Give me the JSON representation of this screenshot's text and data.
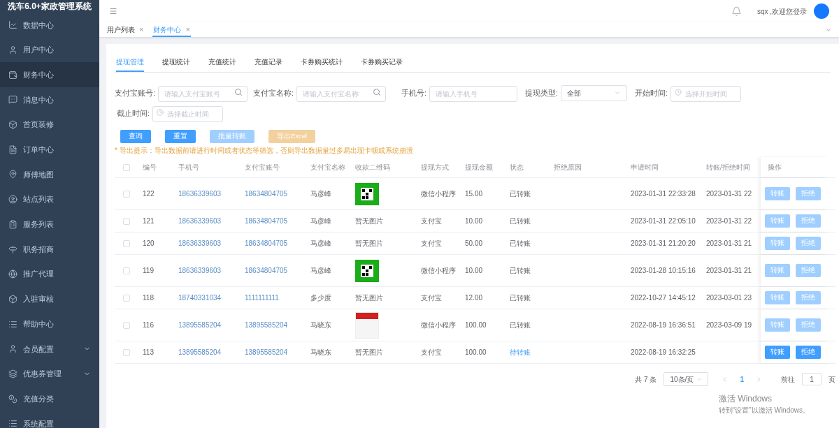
{
  "sidebar": {
    "title": "洗车6.0+家政管理系统",
    "items": [
      {
        "label": "数据中心",
        "selected": false
      },
      {
        "label": "用户中心",
        "selected": false
      },
      {
        "label": "财务中心",
        "selected": true
      },
      {
        "label": "消息中心",
        "selected": false
      },
      {
        "label": "首页装修",
        "selected": false
      },
      {
        "label": "订单中心",
        "selected": false
      },
      {
        "label": "师傅地图",
        "selected": false
      },
      {
        "label": "站点列表",
        "selected": false
      },
      {
        "label": "服务列表",
        "selected": false
      },
      {
        "label": "职务招商",
        "selected": false
      },
      {
        "label": "推广代理",
        "selected": false
      },
      {
        "label": "入驻审核",
        "selected": false
      },
      {
        "label": "帮助中心",
        "selected": false
      },
      {
        "label": "会员配置",
        "selected": false,
        "expanded": false
      },
      {
        "label": "优惠券管理",
        "selected": false,
        "expanded": false
      },
      {
        "label": "充值分类",
        "selected": false
      },
      {
        "label": "系统配置",
        "selected": false
      }
    ]
  },
  "header": {
    "greeting": "sqx ,欢迎您登录"
  },
  "page_tabs": [
    {
      "label": "用户列表",
      "close": "×",
      "selected": false
    },
    {
      "label": "财务中心",
      "close": "×",
      "selected": true
    }
  ],
  "section_tabs": [
    {
      "label": "提现管理",
      "selected": true
    },
    {
      "label": "提现统计",
      "selected": false
    },
    {
      "label": "充值统计",
      "selected": false
    },
    {
      "label": "充值记录",
      "selected": false
    },
    {
      "label": "卡券购买统计",
      "selected": false
    },
    {
      "label": "卡券购买记录",
      "selected": false
    }
  ],
  "filters": [
    {
      "label": "支付宝账号:",
      "kind": "search",
      "placeholder": "请输入支付宝账号"
    },
    {
      "label": "支付宝名称:",
      "kind": "search",
      "placeholder": "请输入支付宝名称"
    },
    {
      "label": "手机号:",
      "kind": "text",
      "placeholder": "请输入手机号"
    },
    {
      "label": "提现类型:",
      "kind": "select",
      "value": "全部"
    },
    {
      "label": "开始时间:",
      "kind": "date",
      "placeholder": "选择开始时间"
    },
    {
      "label": "截止时间:",
      "kind": "date",
      "placeholder": "选择截止时间"
    }
  ],
  "actions": [
    {
      "label": "查询",
      "kind": "primary",
      "disabled": false
    },
    {
      "label": "重置",
      "kind": "primary",
      "disabled": false
    },
    {
      "label": "批量转账",
      "kind": "primary",
      "disabled": true
    },
    {
      "label": "导出Excel",
      "kind": "warning",
      "disabled": true
    }
  ],
  "export_hint": "* 导出提示：导出数据前请进行时间或者状态等筛选，否则导出数据量过多易出现卡顿或系统崩溃",
  "table": {
    "header_checked": false,
    "columns": [
      "编号",
      "手机号",
      "支付宝账号",
      "支付宝名称",
      "收款二维码",
      "提现方式",
      "提现金额",
      "状态",
      "拒绝原因",
      "申请时间",
      "转账/拒绝时间",
      "操作"
    ],
    "rows": [
      {
        "checked": false,
        "id": "122",
        "phone": "18636339603",
        "account": "18634804705",
        "name": "马彦峰",
        "qr": {
          "kind": "qr"
        },
        "method": "微信小程序",
        "amount": "15.00",
        "status": "已转账",
        "pending": false,
        "applied": "2023-01-31 22:33:28",
        "done": "2023-01-31 22",
        "buttons": [
          {
            "label": "转账",
            "disabled": true
          },
          {
            "label": "拒绝",
            "disabled": true
          }
        ]
      },
      {
        "checked": false,
        "id": "121",
        "phone": "18636339603",
        "account": "18634804705",
        "name": "马彦峰",
        "qr": {
          "kind": "none",
          "text": "暂无图片"
        },
        "method": "支付宝",
        "amount": "10.00",
        "status": "已转账",
        "pending": false,
        "applied": "2023-01-31 22:05:10",
        "done": "2023-01-31 22",
        "buttons": [
          {
            "label": "转账",
            "disabled": true
          },
          {
            "label": "拒绝",
            "disabled": true
          }
        ]
      },
      {
        "checked": false,
        "id": "120",
        "phone": "18636339603",
        "account": "18634804705",
        "name": "马彦峰",
        "qr": {
          "kind": "none",
          "text": "暂无图片"
        },
        "method": "支付宝",
        "amount": "50.00",
        "status": "已转账",
        "pending": false,
        "applied": "2023-01-31 21:20:20",
        "done": "2023-01-31 21",
        "buttons": [
          {
            "label": "转账",
            "disabled": true
          },
          {
            "label": "拒绝",
            "disabled": true
          }
        ]
      },
      {
        "checked": false,
        "id": "119",
        "phone": "18636339603",
        "account": "18634804705",
        "name": "马彦峰",
        "qr": {
          "kind": "qr"
        },
        "method": "微信小程序",
        "amount": "10.00",
        "status": "已转账",
        "pending": false,
        "applied": "2023-01-28 10:15:16",
        "done": "2023-01-31 21",
        "buttons": [
          {
            "label": "转账",
            "disabled": true
          },
          {
            "label": "拒绝",
            "disabled": true
          }
        ]
      },
      {
        "checked": false,
        "id": "118",
        "phone": "18740331034",
        "account": "1111111111",
        "name": "多少度",
        "qr": {
          "kind": "none",
          "text": "暂无图片"
        },
        "method": "支付宝",
        "amount": "12.00",
        "status": "已转账",
        "pending": false,
        "applied": "2022-10-27 14:45:12",
        "done": "2023-03-01 23",
        "buttons": [
          {
            "label": "转账",
            "disabled": true
          },
          {
            "label": "拒绝",
            "disabled": true
          }
        ]
      },
      {
        "checked": false,
        "id": "116",
        "phone": "13895585204",
        "account": "13895585204",
        "name": "马晓东",
        "qr": {
          "kind": "screenshot"
        },
        "method": "微信小程序",
        "amount": "100.00",
        "status": "已转账",
        "pending": false,
        "applied": "2022-08-19 16:36:51",
        "done": "2023-03-09 19",
        "buttons": [
          {
            "label": "转账",
            "disabled": true
          },
          {
            "label": "拒绝",
            "disabled": true
          }
        ]
      },
      {
        "checked": false,
        "id": "113",
        "phone": "13895585204",
        "account": "13895585204",
        "name": "马晓东",
        "qr": {
          "kind": "none",
          "text": "暂无图片"
        },
        "method": "支付宝",
        "amount": "100.00",
        "status": "待转账",
        "pending": true,
        "applied": "2022-08-19 16:32:25",
        "buttons": [
          {
            "label": "转账",
            "disabled": false
          },
          {
            "label": "拒绝",
            "disabled": false
          }
        ]
      }
    ]
  },
  "pagination": {
    "total": "共 7 条",
    "page_size": "10条/页",
    "pages": [
      {
        "label": "1",
        "selected": true
      }
    ],
    "goto_label": "前往",
    "goto_value": "1",
    "goto_suffix": "页"
  },
  "os_notice": {
    "title": "激活 Windows",
    "text": "转到“设置”以激活 Windows。"
  }
}
